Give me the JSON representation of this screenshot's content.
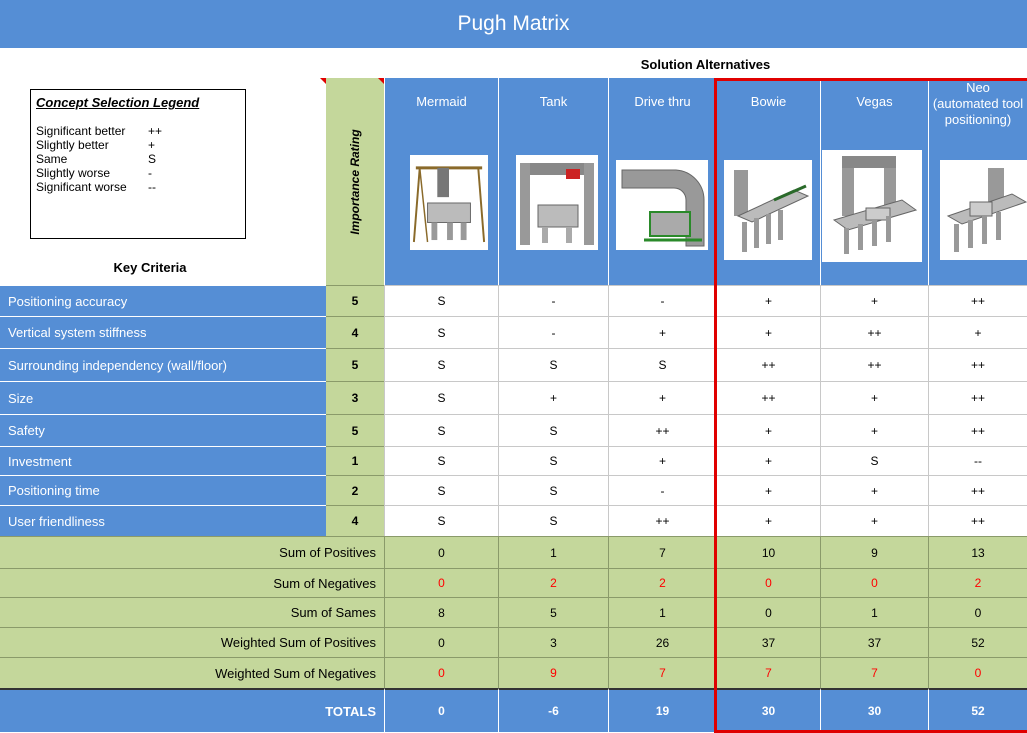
{
  "title": "Pugh Matrix",
  "subtitle": "Solution Alternatives",
  "legend": {
    "title": "Concept Selection Legend",
    "items": [
      {
        "label": "Significant better",
        "symbol": "++"
      },
      {
        "label": "Slightly better",
        "symbol": "+"
      },
      {
        "label": "Same",
        "symbol": "S"
      },
      {
        "label": "Slightly worse",
        "symbol": "-"
      },
      {
        "label": "Significant worse",
        "symbol": "--"
      }
    ]
  },
  "key_criteria_label": "Key Criteria",
  "importance_label": "Importance Rating",
  "alternatives": [
    {
      "name": "Mermaid"
    },
    {
      "name": "Tank"
    },
    {
      "name": "Drive thru"
    },
    {
      "name": "Bowie"
    },
    {
      "name": "Vegas"
    },
    {
      "name": "Neo\n(automated tool\npositioning)"
    }
  ],
  "criteria": [
    {
      "name": "Positioning accuracy",
      "rating": "5",
      "scores": [
        "S",
        "-",
        "-",
        "+",
        "+",
        "++"
      ]
    },
    {
      "name": "Vertical system stiffness",
      "rating": "4",
      "scores": [
        "S",
        "-",
        "+",
        "+",
        "++",
        "+"
      ]
    },
    {
      "name": "Surrounding independency (wall/floor)",
      "rating": "5",
      "scores": [
        "S",
        "S",
        "S",
        "++",
        "++",
        "++"
      ]
    },
    {
      "name": "Size",
      "rating": "3",
      "scores": [
        "S",
        "+",
        "+",
        "++",
        "+",
        "++"
      ]
    },
    {
      "name": "Safety",
      "rating": "5",
      "scores": [
        "S",
        "S",
        "++",
        "+",
        "+",
        "++"
      ]
    },
    {
      "name": "Investment",
      "rating": "1",
      "scores": [
        "S",
        "S",
        "+",
        "+",
        "S",
        "--"
      ]
    },
    {
      "name": "Positioning time",
      "rating": "2",
      "scores": [
        "S",
        "S",
        "-",
        "+",
        "+",
        "++"
      ]
    },
    {
      "name": "User friendliness",
      "rating": "4",
      "scores": [
        "S",
        "S",
        "++",
        "+",
        "+",
        "++"
      ]
    }
  ],
  "summary": [
    {
      "label": "Sum of Positives",
      "values": [
        "0",
        "1",
        "7",
        "10",
        "9",
        "13"
      ],
      "red": false
    },
    {
      "label": "Sum of Negatives",
      "values": [
        "0",
        "2",
        "2",
        "0",
        "0",
        "2"
      ],
      "red": true
    },
    {
      "label": "Sum of Sames",
      "values": [
        "8",
        "5",
        "1",
        "0",
        "1",
        "0"
      ],
      "red": false
    },
    {
      "label": "Weighted Sum of Positives",
      "values": [
        "0",
        "3",
        "26",
        "37",
        "37",
        "52"
      ],
      "red": false
    },
    {
      "label": "Weighted Sum of Negatives",
      "values": [
        "0",
        "9",
        "7",
        "7",
        "7",
        "0"
      ],
      "red": true
    }
  ],
  "totals": {
    "label": "TOTALS",
    "values": [
      "0",
      "-6",
      "19",
      "30",
      "30",
      "52"
    ]
  },
  "colors": {
    "header_blue": "#558ed5",
    "rating_green": "#c4d79b",
    "negative_red": "#ff0000",
    "highlight_border": "#e00000"
  }
}
